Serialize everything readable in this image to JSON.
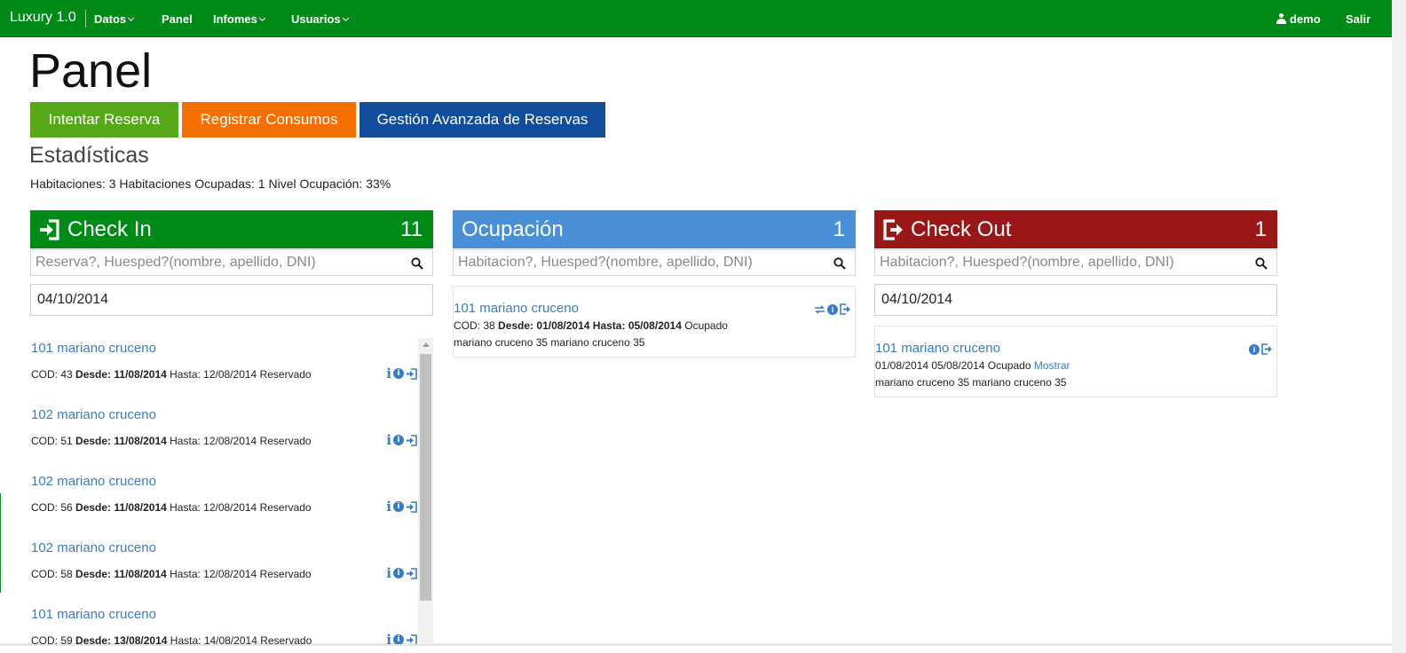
{
  "navbar": {
    "brand": "Luxury 1.0",
    "items": [
      {
        "label": "Datos",
        "dropdown": true
      },
      {
        "label": "Panel",
        "dropdown": false
      },
      {
        "label": "Infomes",
        "dropdown": true
      },
      {
        "label": "Usuarios",
        "dropdown": true
      }
    ],
    "user": "demo",
    "logout": "Salir"
  },
  "page": {
    "title": "Panel",
    "buttons": {
      "intentar": "Intentar Reserva",
      "consumos": "Registrar Consumos",
      "gestion": "Gestión Avanzada de Reservas"
    },
    "stats_title": "Estadísticas",
    "stats_line": "Habitaciones: 3 Habitaciones Ocupadas: 1 Nivel Ocupación: 33%"
  },
  "colors": {
    "navbar": "#008a17",
    "checkin": "#008a17",
    "ocupacion": "#4a90d8",
    "checkout": "#9a1717",
    "btn_intentar": "#57a819",
    "btn_consumos": "#f56e00",
    "btn_gestion": "#124c9a",
    "link": "#3a7cc4"
  },
  "checkin": {
    "title": "Check In",
    "count": "11",
    "icon": "sign-in-icon",
    "search_placeholder": "Reserva?, Huesped?(nombre, apellido, DNI)",
    "date": "04/10/2014",
    "items": [
      {
        "name": "101 mariano cruceno",
        "cod": "COD: 43",
        "desde_label": "Desde:",
        "desde": "11/08/2014",
        "hasta": "Hasta: 12/08/2014",
        "estado": "Reservado"
      },
      {
        "name": "102 mariano cruceno",
        "cod": "COD: 51",
        "desde_label": "Desde:",
        "desde": "11/08/2014",
        "hasta": "Hasta: 12/08/2014",
        "estado": "Reservado"
      },
      {
        "name": "102 mariano cruceno",
        "cod": "COD: 56",
        "desde_label": "Desde:",
        "desde": "11/08/2014",
        "hasta": "Hasta: 12/08/2014",
        "estado": "Reservado"
      },
      {
        "name": "102 mariano cruceno",
        "cod": "COD: 58",
        "desde_label": "Desde:",
        "desde": "11/08/2014",
        "hasta": "Hasta: 12/08/2014",
        "estado": "Reservado"
      },
      {
        "name": "101 mariano cruceno",
        "cod": "COD: 59",
        "desde_label": "Desde:",
        "desde": "13/08/2014",
        "hasta": "Hasta: 14/08/2014",
        "estado": "Reservado"
      }
    ]
  },
  "ocupacion": {
    "title": "Ocupación",
    "count": "1",
    "search_placeholder": "Habitacion?, Huesped?(nombre, apellido, DNI)",
    "item": {
      "name": "101 mariano cruceno",
      "cod": "COD: 38",
      "desde_label": "Desde:",
      "desde": "01/08/2014",
      "hasta_label": "Hasta:",
      "hasta": "05/08/2014",
      "estado": "Ocupado",
      "huespedes": "mariano cruceno 35 mariano cruceno 35"
    }
  },
  "checkout": {
    "title": "Check Out",
    "count": "1",
    "icon": "sign-out-icon",
    "search_placeholder": "Habitacion?, Huesped?(nombre, apellido, DNI)",
    "date": "04/10/2014",
    "item": {
      "name": "101 mariano cruceno",
      "fechas": "01/08/2014 05/08/2014 Ocupado",
      "mostrar": "Mostrar",
      "huespedes": "mariano cruceno 35 mariano cruceno 35"
    }
  }
}
